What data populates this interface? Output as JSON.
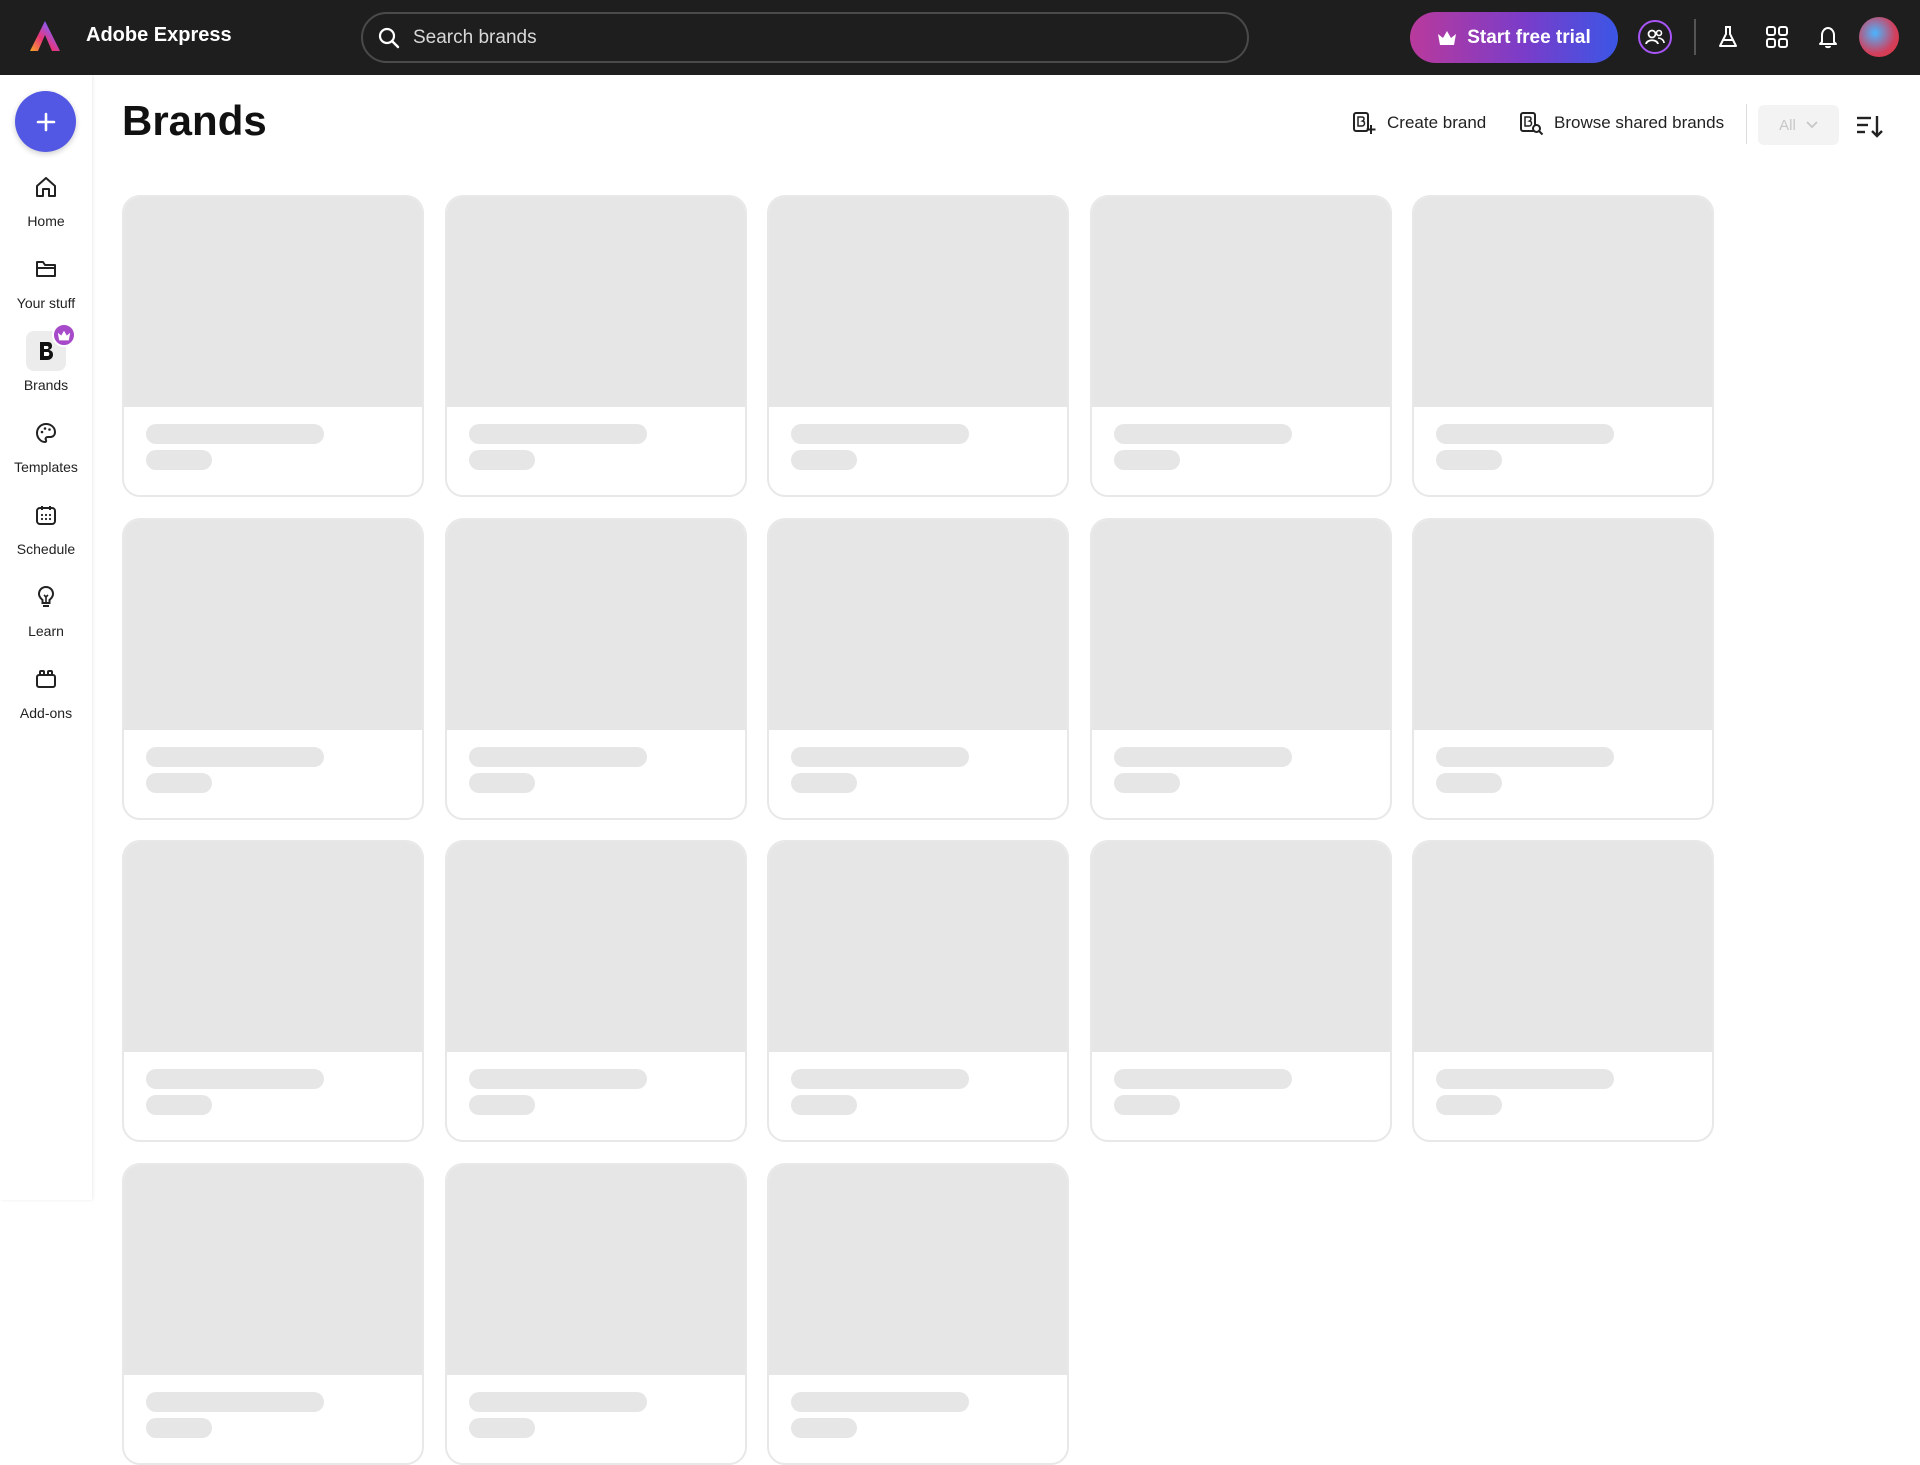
{
  "header": {
    "app_title": "Adobe Express",
    "search_placeholder": "Search brands",
    "trial_label": "Start free trial"
  },
  "sidebar": {
    "items": [
      {
        "label": "Home",
        "icon": "home-icon"
      },
      {
        "label": "Your stuff",
        "icon": "folder-icon"
      },
      {
        "label": "Brands",
        "icon": "brand-icon",
        "active": true
      },
      {
        "label": "Templates",
        "icon": "templates-icon"
      },
      {
        "label": "Schedule",
        "icon": "calendar-icon"
      },
      {
        "label": "Learn",
        "icon": "lightbulb-icon"
      },
      {
        "label": "Add-ons",
        "icon": "addons-icon"
      }
    ]
  },
  "main": {
    "title": "Brands",
    "create_label": "Create brand",
    "browse_label": "Browse shared brands",
    "filter_value": "All"
  },
  "colors": {
    "topbar": "#1e1e1e",
    "accent": "#5258e4",
    "skeleton": "#e6e6e6",
    "badge": "#a64ac9"
  }
}
